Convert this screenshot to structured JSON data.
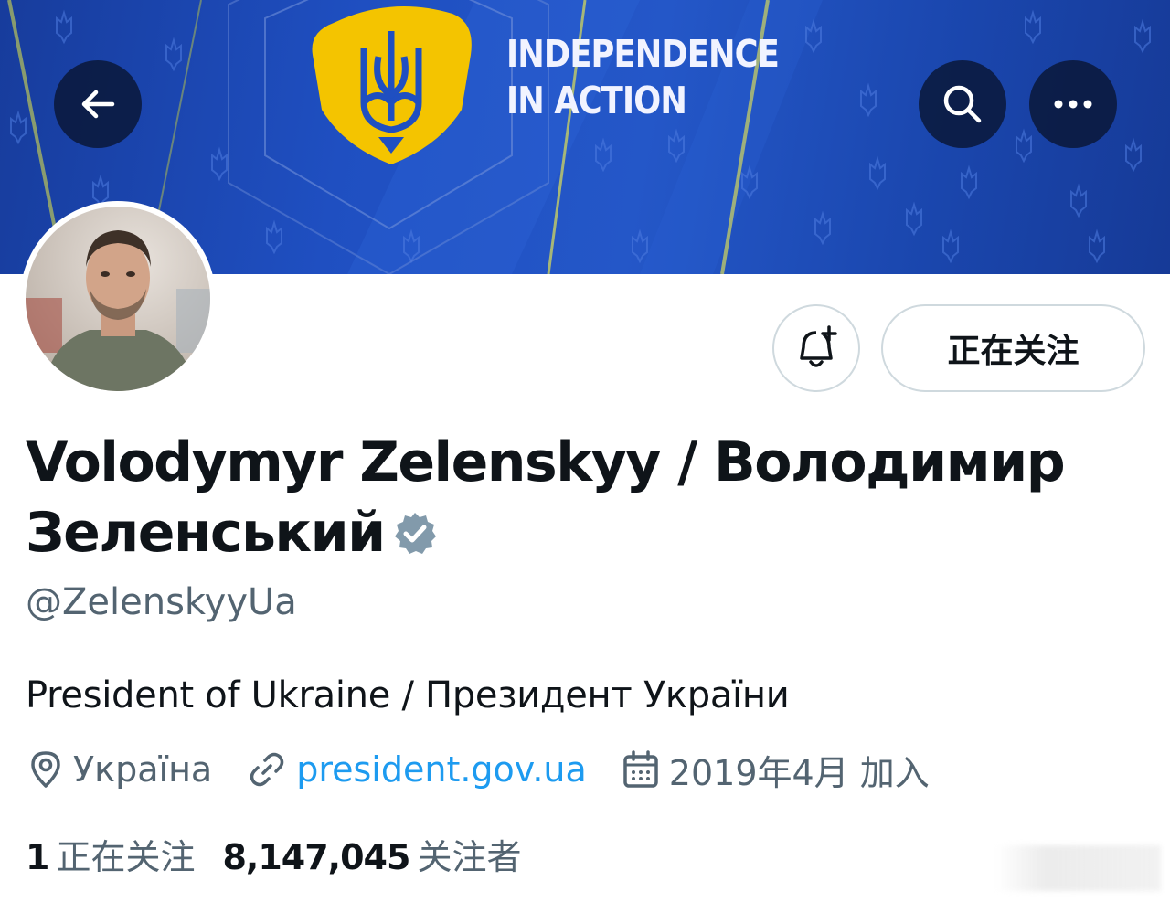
{
  "banner": {
    "headline_line1": "INDEPENDENCE",
    "headline_line2": "IN ACTION",
    "background_color": "#1f4fc1",
    "emblem_color": "#f4c400",
    "trident_color": "#1f4fc1"
  },
  "header": {
    "back_icon": "arrow-left-icon",
    "search_icon": "search-icon",
    "more_icon": "more-horizontal-icon"
  },
  "profile": {
    "display_name": "Volodymyr Zelenskyy / Володимир Зеленський",
    "verified": true,
    "handle": "@ZelenskyyUa",
    "bio": "President of Ukraine / Президент України",
    "location": "Україна",
    "website": "president.gov.ua",
    "joined": "2019年4月 加入"
  },
  "actions": {
    "notify_icon": "bell-plus-icon",
    "following_label": "正在关注"
  },
  "stats": {
    "following_count": "1",
    "following_label": "正在关注",
    "followers_count": "8,147,045",
    "followers_label": "关注者"
  },
  "colors": {
    "link": "#1d9bf0",
    "secondary_text": "#536471",
    "primary_text": "#0f1419",
    "border": "#cfd9de",
    "verified_badge": "#829aab"
  }
}
